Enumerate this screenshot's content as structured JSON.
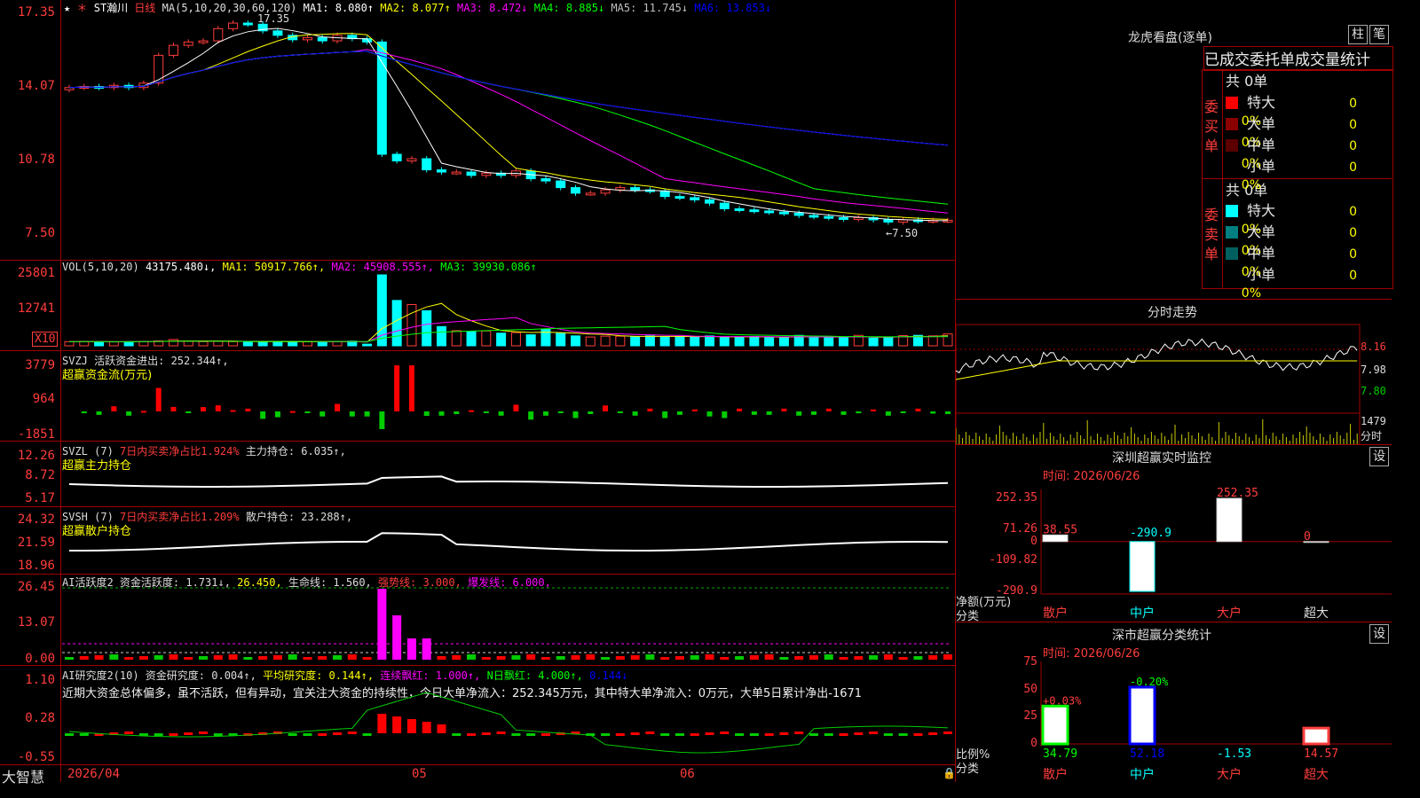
{
  "stock": {
    "title": "ST瀚川",
    "period": "日线"
  },
  "main_panel": {
    "ma_text": "MA(5,10,20,30,60,120)",
    "ma_items": [
      {
        "label": "MA1: 8.080↑",
        "color": "#ffffff"
      },
      {
        "label": "MA2: 8.077↑",
        "color": "#ffff00"
      },
      {
        "label": "MA3: 8.472↓",
        "color": "#ff00ff"
      },
      {
        "label": "MA4: 8.885↓",
        "color": "#00ff00"
      },
      {
        "label": "MA5: 11.745↓",
        "color": "#c0c0c0"
      },
      {
        "label": "MA6: 13.853↓",
        "color": "#0000ff"
      }
    ],
    "y_ticks": [
      "17.35",
      "14.07",
      "10.78",
      "7.50"
    ],
    "high_label": "17.35",
    "low_label": "←7.50"
  },
  "vol_panel": {
    "header": "VOL(5,10,20)",
    "items": [
      {
        "label": "43175.480↓,",
        "color": "#ffffff"
      },
      {
        "label": "MA1: 50917.766↑,",
        "color": "#ffff00"
      },
      {
        "label": "MA2: 45908.555↑,",
        "color": "#ff00ff"
      },
      {
        "label": "MA3: 39930.086↑",
        "color": "#00ff00"
      }
    ],
    "y_ticks": [
      "25801",
      "12741"
    ],
    "unit": "X10"
  },
  "svzj_panel": {
    "header": "SVZJ  活跃资金进出: 252.344↑,",
    "subtitle": "超赢资金流(万元)",
    "y_ticks": [
      "3779",
      "964",
      "-1851"
    ]
  },
  "svzl_panel": {
    "header_a": "SVZL (7)",
    "header_b": "7日内买卖净占比1.924%",
    "header_c": "主力持仓: 6.035↑,",
    "subtitle": "超赢主力持仓",
    "y_ticks": [
      "12.26",
      "8.72",
      "5.17"
    ]
  },
  "svsh_panel": {
    "header_a": "SVSH (7)",
    "header_b": "7日内买卖净占比1.209%",
    "header_c": "散户持仓: 23.288↑,",
    "subtitle": "超赢散户持仓",
    "y_ticks": [
      "24.32",
      "21.59",
      "18.96"
    ]
  },
  "ai_active_panel": {
    "header_a": "AI活跃度2 资金活跃度: 1.731↓,",
    "header_b": "26.450,",
    "header_c": "生命线: 1.560,",
    "header_d": "强势线: 3.000,",
    "header_e": "爆发线: 6.000,",
    "y_ticks": [
      "26.45",
      "13.07",
      "0.00"
    ]
  },
  "ai_research_panel": {
    "header_a": "AI研究度2(10) 资金研究度: 0.004↑,",
    "header_b": "平均研究度: 0.144↑,",
    "header_c": "连续飘红: 1.000↑,",
    "header_d": "N日飘红: 4.000↑,",
    "header_e": "0.144↓",
    "comment": "近期大资金总体偏多，虽不活跃，但有异动，宜关注大资金的持续性，今日大单净流入：252.345万元，其中特大单净流入：0万元，大单5日累计净出-1671",
    "y_ticks": [
      "1.10",
      "0.28",
      "-0.55"
    ]
  },
  "bottom_bar": {
    "brand": "大智慧",
    "date": "2026/04",
    "m5": "05",
    "m6": "06"
  },
  "dragon": {
    "title": "龙虎看盘(逐单)",
    "btn_a": "柱",
    "btn_b": "笔",
    "subtitle": "已成交委托单成交量统计",
    "buy_label": "委买单",
    "sell_label": "委卖单",
    "buy_total": "共 0单",
    "sell_total": "共 0单",
    "buy_rows": [
      {
        "name": "特大",
        "count": "0",
        "pct": "0%",
        "color": "#ff0000"
      },
      {
        "name": "大单",
        "count": "0",
        "pct": "0%",
        "color": "#8b0000"
      },
      {
        "name": "中单",
        "count": "0",
        "pct": "0%",
        "color": "#5a0000"
      },
      {
        "name": "小单",
        "count": "0",
        "pct": "0%",
        "color": ""
      }
    ],
    "sell_rows": [
      {
        "name": "特大",
        "count": "0",
        "pct": "0%",
        "color": "#00ffff"
      },
      {
        "name": "大单",
        "count": "0",
        "pct": "0%",
        "color": "#008080"
      },
      {
        "name": "中单",
        "count": "0",
        "pct": "0%",
        "color": "#006060"
      },
      {
        "name": "小单",
        "count": "0",
        "pct": "0%",
        "color": ""
      }
    ]
  },
  "intraday": {
    "title": "分时走势",
    "prices": [
      "8.16",
      "7.98",
      "7.80"
    ],
    "vol_label": "1479",
    "vol_unit": "分时"
  },
  "monitor": {
    "title": "深圳超赢实时监控",
    "btn": "设",
    "time": "时间: 2026/06/26",
    "y_ticks": [
      "252.35",
      "71.26",
      "0",
      "-109.82",
      "-290.9"
    ],
    "y_label": "净额(万元)",
    "x_label": "分类",
    "categories": [
      "散户",
      "中户",
      "大户",
      "超大"
    ],
    "values": [
      38.55,
      -290.9,
      252.35,
      0
    ],
    "value_labels": [
      "38.55",
      "-290.9",
      "252.35",
      "0"
    ]
  },
  "classify": {
    "title": "深市超赢分类统计",
    "btn": "设",
    "time": "时间: 2026/06/26",
    "y_ticks": [
      "75",
      "50",
      "25",
      "0"
    ],
    "y_label": "比例%",
    "x_label": "分类",
    "categories": [
      "散户",
      "中户",
      "大户",
      "超大"
    ],
    "values": [
      34.79,
      52.18,
      -1.53,
      14.57
    ],
    "value_labels": [
      "34.79",
      "52.18",
      "-1.53",
      "14.57"
    ],
    "changes": [
      "+0.03%",
      "-0.20%"
    ]
  },
  "chart_data": [
    {
      "type": "candlestick",
      "title": "ST瀚川 日线",
      "close": [
        14.05,
        14.1,
        14.05,
        14.15,
        14.05,
        14.25,
        15.5,
        15.95,
        16.1,
        16.15,
        16.7,
        16.95,
        16.9,
        16.6,
        16.4,
        16.2,
        16.3,
        16.15,
        16.4,
        16.25,
        16.1,
        11.05,
        10.75,
        10.85,
        10.35,
        10.25,
        10.25,
        10.1,
        10.2,
        10.1,
        10.3,
        9.95,
        9.85,
        9.55,
        9.3,
        9.3,
        9.45,
        9.55,
        9.45,
        9.4,
        9.15,
        9.1,
        9.0,
        8.85,
        8.6,
        8.55,
        8.5,
        8.45,
        8.4,
        8.3,
        8.25,
        8.2,
        8.15,
        8.2,
        8.1,
        8.0,
        8.1,
        8.05,
        8.08,
        8.08
      ],
      "ylim": [
        7.5,
        17.35
      ]
    },
    {
      "type": "bar",
      "title": "VOL(5,10,20)",
      "values": [
        1500,
        1600,
        1500,
        1400,
        1500,
        1600,
        1800,
        2300,
        1700,
        1500,
        1600,
        1500,
        1500,
        1400,
        1600,
        1500,
        1500,
        1500,
        1500,
        1700,
        600,
        25800,
        16500,
        15000,
        12741,
        7000,
        5500,
        5300,
        5400,
        4600,
        4800,
        4000,
        6000,
        4500,
        3600,
        3200,
        3500,
        3500,
        3400,
        3600,
        3200,
        3400,
        3200,
        3600,
        3000,
        3200,
        3400,
        3100,
        3000,
        3800,
        3000,
        3100,
        3000,
        3800,
        2800,
        3000,
        3700,
        3800,
        3600,
        4300
      ],
      "ylim": [
        0,
        25801
      ]
    }
  ]
}
